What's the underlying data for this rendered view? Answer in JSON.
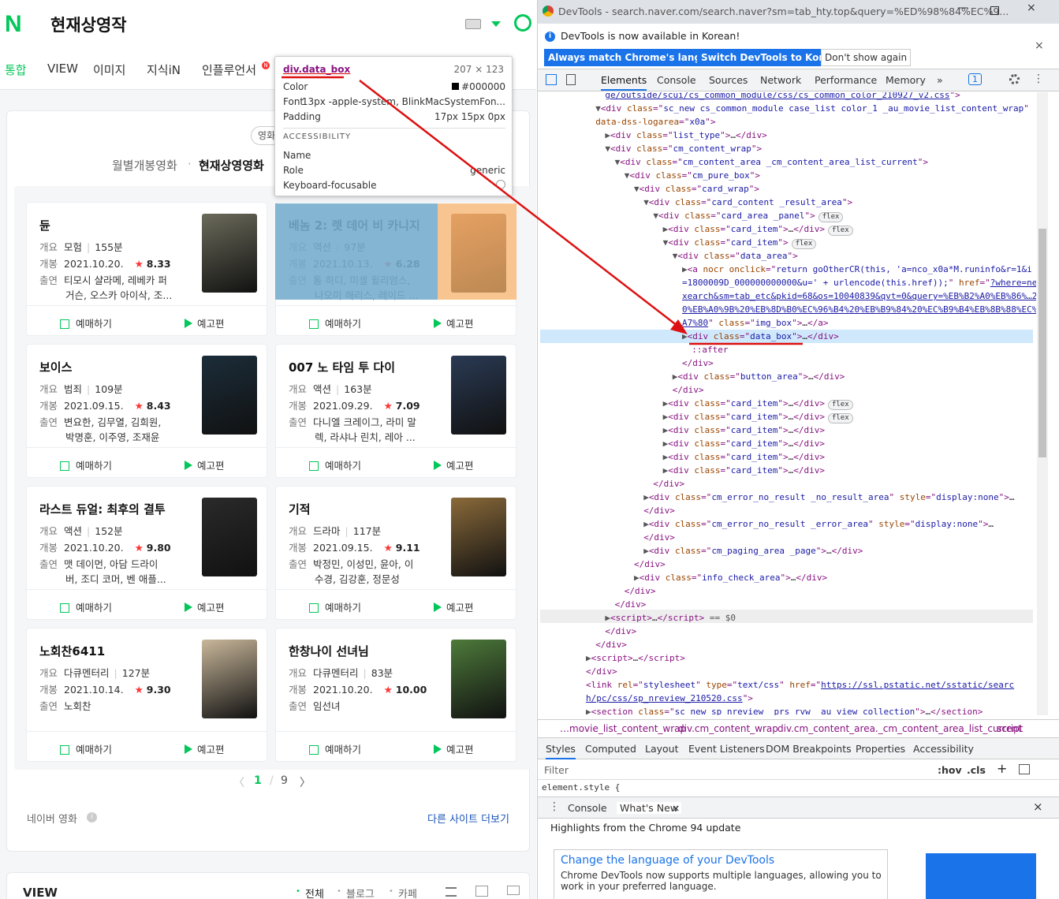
{
  "naver": {
    "logo": "N",
    "query": "현재상영작",
    "tabs": [
      "통합",
      "VIEW",
      "이미지",
      "지식iN",
      "인플루언서"
    ],
    "badge": "N",
    "pill": "영화",
    "subtabs": [
      "월별개봉영화",
      "현재상영영화"
    ],
    "subtab_dot": "·",
    "labels": {
      "genre": "개요",
      "release": "개봉",
      "cast": "출연",
      "book": "예매하기",
      "trailer": "예고편"
    },
    "movies": [
      {
        "title": "듄",
        "genre": "모험",
        "runtime": "155분",
        "date": "2021.10.20.",
        "score": "8.33",
        "cast1": "티모시 샬라메, 레베카 퍼",
        "cast2": "거슨, 오스카 아이삭, 조..."
      },
      {
        "title": "베놈 2: 렛 데어 비 카니지",
        "genre": "액션",
        "runtime": "97분",
        "date": "2021.10.13.",
        "score": "6.28",
        "cast1": "톰 하디, 미셸 윌리엄스,",
        "cast2": "나오미 해리스, 레이드 ..."
      },
      {
        "title": "보이스",
        "genre": "범죄",
        "runtime": "109분",
        "date": "2021.09.15.",
        "score": "8.43",
        "cast1": "변요한, 김무열, 김희원,",
        "cast2": "박명훈, 이주영, 조재윤"
      },
      {
        "title": "007 노 타임 투 다이",
        "genre": "액션",
        "runtime": "163분",
        "date": "2021.09.29.",
        "score": "7.09",
        "cast1": "다니엘 크레이그, 라미 말",
        "cast2": "렉, 라샤나 린치, 레아 ..."
      },
      {
        "title": "라스트 듀얼: 최후의 결투",
        "genre": "액션",
        "runtime": "152분",
        "date": "2021.10.20.",
        "score": "9.80",
        "cast1": "맷 데이먼, 아담 드라이",
        "cast2": "버, 조디 코머, 벤 애플..."
      },
      {
        "title": "기적",
        "genre": "드라마",
        "runtime": "117분",
        "date": "2021.09.15.",
        "score": "9.11",
        "cast1": "박정민, 이성민, 윤아, 이",
        "cast2": "수경, 김강훈, 정문성"
      },
      {
        "title": "노회찬6411",
        "genre": "다큐멘터리",
        "runtime": "127분",
        "date": "2021.10.14.",
        "score": "9.30",
        "cast1": "노회찬",
        "cast2": ""
      },
      {
        "title": "한창나이 선녀님",
        "genre": "다큐멘터리",
        "runtime": "83분",
        "date": "2021.10.20.",
        "score": "10.00",
        "cast1": "임선녀",
        "cast2": ""
      }
    ],
    "pager": {
      "current": "1",
      "sep": "/",
      "total": "9",
      "prev": "〈",
      "next": "〉"
    },
    "footer": {
      "left": "네이버 영화",
      "info": "i",
      "right": "다른 사이트 더보기"
    },
    "view": {
      "title": "VIEW",
      "all": "전체",
      "blog": "블로그",
      "cafe": "카페",
      "bullet": "•"
    },
    "tooltip": {
      "name": "div.data_box",
      "size": "207 × 123",
      "color_label": "Color",
      "color_value": "#000000",
      "font_label": "Font",
      "font_value": "13px -apple-system, BlinkMacSystemFon...",
      "padding_label": "Padding",
      "padding_value": "17px 15px 0px",
      "acc": "ACCESSIBILITY",
      "name_label": "Name",
      "role_label": "Role",
      "role_value": "generic",
      "kf_label": "Keyboard-focusable"
    }
  },
  "devtools": {
    "window_title": "DevTools - search.naver.com/search.naver?sm=tab_hty.top&query=%ED%98%84%EC%9...",
    "info": "DevTools is now available in Korean!",
    "info_i": "i",
    "btn_match": "Always match Chrome's language",
    "btn_switch": "Switch DevTools to Korean",
    "btn_dont": "Don't show again",
    "tabs": [
      "Elements",
      "Console",
      "Sources",
      "Network",
      "Performance",
      "Memory"
    ],
    "more_tabs": "»",
    "issues": "1",
    "code": [
      {
        "i": 7,
        "h": "<span class='lk'>ge/outside/scui/cs_common_module/css/cs_common_color_210927_v2.css</span><span class='tg'>\"></span>"
      },
      {
        "i": 6,
        "h": "<span class='cm'>▼</span><span class='tg'>&lt;div </span><span class='at'>class</span><span class='tg'>=\"</span><span class='av'>sc_new cs_common_module case_list color_1 _au_movie_list_content_wrap</span><span class='tg'>\"</span>"
      },
      {
        "i": 6,
        "h": "<span class='at'>data-dss-logarea</span><span class='tg'>=\"</span><span class='av'>x0a</span><span class='tg'>\"&gt;</span>"
      },
      {
        "i": 7,
        "h": "<span class='cm'>▶</span><span class='tg'>&lt;div </span><span class='at'>class</span><span class='tg'>=\"</span><span class='av'>list_type</span><span class='tg'>\"&gt;</span>…<span class='tg'>&lt;/div&gt;</span>"
      },
      {
        "i": 7,
        "h": "<span class='cm'>▼</span><span class='tg'>&lt;div </span><span class='at'>class</span><span class='tg'>=\"</span><span class='av'>cm_content_wrap</span><span class='tg'>\"&gt;</span>"
      },
      {
        "i": 8,
        "h": "<span class='cm'>▼</span><span class='tg'>&lt;div </span><span class='at'>class</span><span class='tg'>=\"</span><span class='av'>cm_content_area _cm_content_area_list_current</span><span class='tg'>\"&gt;</span>"
      },
      {
        "i": 9,
        "h": "<span class='cm'>▼</span><span class='tg'>&lt;div </span><span class='at'>class</span><span class='tg'>=\"</span><span class='av'>cm_pure_box</span><span class='tg'>\"&gt;</span>"
      },
      {
        "i": 10,
        "h": "<span class='cm'>▼</span><span class='tg'>&lt;div </span><span class='at'>class</span><span class='tg'>=\"</span><span class='av'>card_wrap</span><span class='tg'>\"&gt;</span>"
      },
      {
        "i": 11,
        "h": "<span class='cm'>▼</span><span class='tg'>&lt;div </span><span class='at'>class</span><span class='tg'>=\"</span><span class='av'>card_content _result_area</span><span class='tg'>\"&gt;</span>"
      },
      {
        "i": 12,
        "h": "<span class='cm'>▼</span><span class='tg'>&lt;div </span><span class='at'>class</span><span class='tg'>=\"</span><span class='av'>card_area _panel</span><span class='tg'>\"&gt;</span><span class='fx'>flex</span>"
      },
      {
        "i": 13,
        "h": "<span class='cm'>▶</span><span class='tg'>&lt;div </span><span class='at'>class</span><span class='tg'>=\"</span><span class='av'>card_item</span><span class='tg'>\"&gt;</span>…<span class='tg'>&lt;/div&gt;</span><span class='fx'>flex</span>"
      },
      {
        "i": 13,
        "h": "<span class='cm'>▼</span><span class='tg'>&lt;div </span><span class='at'>class</span><span class='tg'>=\"</span><span class='av'>card_item</span><span class='tg'>\"&gt;</span><span class='fx'>flex</span>"
      },
      {
        "i": 14,
        "h": "<span class='cm'>▼</span><span class='tg'>&lt;div </span><span class='at'>class</span><span class='tg'>=\"</span><span class='av'>data_area</span><span class='tg'>\"&gt;</span>"
      },
      {
        "i": 15,
        "h": "<span class='cm'>▶</span><span class='tg'>&lt;a </span><span class='at'>nocr onclick</span><span class='tg'>=\"</span><span class='av'>return goOtherCR(this, 'a=nco_x0a*M.runinfo&amp;r=1&amp;i</span>"
      },
      {
        "i": 15,
        "h": "<span class='av'>=1800009D_000000000000&amp;u=' + urlencode(this.href));</span><span class='tg'>\" </span><span class='at'>href</span><span class='tg'>=\"</span><span class='lk'>?where=ne</span>"
      },
      {
        "i": 15,
        "h": "<span class='lk'>xearch&amp;sm=tab_etc&amp;pkid=68&amp;os=10040839&amp;qvt=0&amp;query=%EB%B2%A0%EB%86%…2</span>"
      },
      {
        "i": 15,
        "h": "<span class='lk'>0%EB%A0%9B%20%EB%8D%B0%EC%96%B4%20%EB%B9%84%20%EC%B9%B4%EB%8B%88%EC%</span>"
      },
      {
        "i": 15,
        "h": "<span class='lk'>A7%80</span><span class='tg'>\" </span><span class='at'>class</span><span class='tg'>=\"</span><span class='av'>img_box</span><span class='tg'>\"&gt;</span>…<span class='tg'>&lt;/a&gt;</span>"
      },
      {
        "i": 15,
        "h": "<span class='cm'>▶</span><span class='tg'>&lt;div </span><span class='at'>class</span><span class='tg'>=\"</span><span class='av'>data_box</span><span class='tg'>\"&gt;</span>…<span class='tg'>&lt;/div&gt;</span>"
      },
      {
        "i": 16,
        "h": "<span class='tg'>::after</span>"
      },
      {
        "i": 15,
        "h": "<span class='tg'>&lt;/div&gt;</span>"
      },
      {
        "i": 14,
        "h": "<span class='cm'>▶</span><span class='tg'>&lt;div </span><span class='at'>class</span><span class='tg'>=\"</span><span class='av'>button_area</span><span class='tg'>\"&gt;</span>…<span class='tg'>&lt;/div&gt;</span>"
      },
      {
        "i": 14,
        "h": "<span class='tg'>&lt;/div&gt;</span>"
      },
      {
        "i": 13,
        "h": "<span class='cm'>▶</span><span class='tg'>&lt;div </span><span class='at'>class</span><span class='tg'>=\"</span><span class='av'>card_item</span><span class='tg'>\"&gt;</span>…<span class='tg'>&lt;/div&gt;</span><span class='fx'>flex</span>"
      },
      {
        "i": 13,
        "h": "<span class='cm'>▶</span><span class='tg'>&lt;div </span><span class='at'>class</span><span class='tg'>=\"</span><span class='av'>card_item</span><span class='tg'>\"&gt;</span>…<span class='tg'>&lt;/div&gt;</span><span class='fx'>flex</span>"
      },
      {
        "i": 13,
        "h": "<span class='cm'>▶</span><span class='tg'>&lt;div </span><span class='at'>class</span><span class='tg'>=\"</span><span class='av'>card_item</span><span class='tg'>\"&gt;</span>…<span class='tg'>&lt;/div&gt;</span>"
      },
      {
        "i": 13,
        "h": "<span class='cm'>▶</span><span class='tg'>&lt;div </span><span class='at'>class</span><span class='tg'>=\"</span><span class='av'>card_item</span><span class='tg'>\"&gt;</span>…<span class='tg'>&lt;/div&gt;</span>"
      },
      {
        "i": 13,
        "h": "<span class='cm'>▶</span><span class='tg'>&lt;div </span><span class='at'>class</span><span class='tg'>=\"</span><span class='av'>card_item</span><span class='tg'>\"&gt;</span>…<span class='tg'>&lt;/div&gt;</span>"
      },
      {
        "i": 13,
        "h": "<span class='cm'>▶</span><span class='tg'>&lt;div </span><span class='at'>class</span><span class='tg'>=\"</span><span class='av'>card_item</span><span class='tg'>\"&gt;</span>…<span class='tg'>&lt;/div&gt;</span>"
      },
      {
        "i": 12,
        "h": "<span class='tg'>&lt;/div&gt;</span>"
      },
      {
        "i": 11,
        "h": "<span class='cm'>▶</span><span class='tg'>&lt;div </span><span class='at'>class</span><span class='tg'>=\"</span><span class='av'>cm_error_no_result _no_result_area</span><span class='tg'>\" </span><span class='at'>style</span><span class='tg'>=\"</span><span class='av'>display:none</span><span class='tg'>\"&gt;</span>…"
      },
      {
        "i": 11,
        "h": "<span class='tg'>&lt;/div&gt;</span>"
      },
      {
        "i": 11,
        "h": "<span class='cm'>▶</span><span class='tg'>&lt;div </span><span class='at'>class</span><span class='tg'>=\"</span><span class='av'>cm_error_no_result _error_area</span><span class='tg'>\" </span><span class='at'>style</span><span class='tg'>=\"</span><span class='av'>display:none</span><span class='tg'>\"&gt;</span>…"
      },
      {
        "i": 11,
        "h": "<span class='tg'>&lt;/div&gt;</span>"
      },
      {
        "i": 11,
        "h": "<span class='cm'>▶</span><span class='tg'>&lt;div </span><span class='at'>class</span><span class='tg'>=\"</span><span class='av'>cm_paging_area _page</span><span class='tg'>\"&gt;</span>…<span class='tg'>&lt;/div&gt;</span>"
      },
      {
        "i": 10,
        "h": "<span class='tg'>&lt;/div&gt;</span>"
      },
      {
        "i": 10,
        "h": "<span class='cm'>▶</span><span class='tg'>&lt;div </span><span class='at'>class</span><span class='tg'>=\"</span><span class='av'>info_check_area</span><span class='tg'>\"&gt;</span>…<span class='tg'>&lt;/div&gt;</span>"
      },
      {
        "i": 9,
        "h": "<span class='tg'>&lt;/div&gt;</span>"
      },
      {
        "i": 8,
        "h": "<span class='tg'>&lt;/div&gt;</span>"
      },
      {
        "i": 7,
        "h": "<span class='cm'>▶</span><span class='tg'>&lt;script&gt;</span>…<span class='tg'>&lt;/script&gt;</span> <span class='cm'>== $0</span>"
      },
      {
        "i": 7,
        "h": "<span class='tg'>&lt;/div&gt;</span>"
      },
      {
        "i": 6,
        "h": "<span class='tg'>&lt;/div&gt;</span>"
      },
      {
        "i": 5,
        "h": "<span class='cm'>▶</span><span class='tg'>&lt;script&gt;</span>…<span class='tg'>&lt;/script&gt;</span>"
      },
      {
        "i": 5,
        "h": "<span class='tg'>&lt;/div&gt;</span>"
      },
      {
        "i": 5,
        "h": "<span class='tg'>&lt;link </span><span class='at'>rel</span><span class='tg'>=\"</span><span class='av'>stylesheet</span><span class='tg'>\" </span><span class='at'>type</span><span class='tg'>=\"</span><span class='av'>text/css</span><span class='tg'>\" </span><span class='at'>href</span><span class='tg'>=\"</span><span class='lk'>https://ssl.pstatic.net/sstatic/searc</span>"
      },
      {
        "i": 5,
        "h": "<span class='lk'>h/pc/css/sp_nreview_210520.css</span><span class='tg'>\"&gt;</span>"
      },
      {
        "i": 5,
        "h": "<span class='cm'>▶</span><span class='tg'>&lt;section </span><span class='at'>class</span><span class='tg'>=\"</span><span class='av'>sc_new sp_nreview _prs_rvw _au_view_collection</span><span class='tg'>\"&gt;</span>…<span class='tg'>&lt;/section&gt;</span>"
      }
    ],
    "crumbs": [
      "…movie_list_content_wrap",
      "div.cm_content_wrap",
      "div.cm_content_area._cm_content_area_list_current",
      "script"
    ],
    "style_tabs": [
      "Styles",
      "Computed",
      "Layout",
      "Event Listeners",
      "DOM Breakpoints",
      "Properties",
      "Accessibility"
    ],
    "filter": "Filter",
    "hov": ":hov",
    "cls": ".cls",
    "plus": "+",
    "element_style": "element.style {",
    "drawer_tabs": [
      "Console",
      "What's New"
    ],
    "close": "×",
    "highlights": "Highlights from the Chrome 94 update",
    "wn_title": "Change the language of your DevTools",
    "wn_desc": "Chrome DevTools now supports multiple languages, allowing you to work in your preferred language."
  },
  "colors": {
    "naver_green": "#03c75a",
    "devtools_blue": "#1a73e8",
    "star_red": "#ff3333",
    "arrow_red": "#dd1111"
  }
}
